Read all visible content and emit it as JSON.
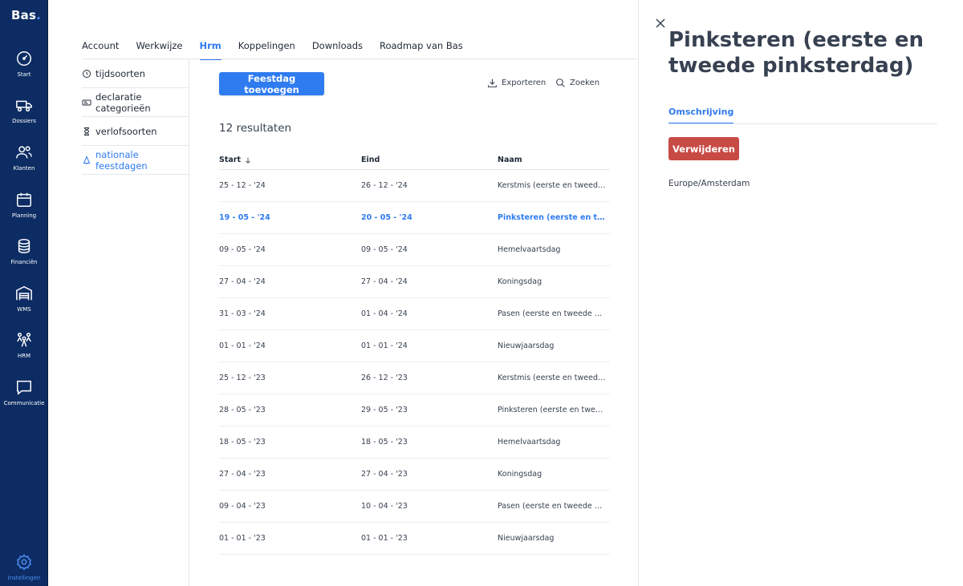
{
  "brand": {
    "name": "Bas",
    "dot": "."
  },
  "rail": [
    {
      "label": "Start",
      "icon": "gauge-icon"
    },
    {
      "label": "Dossiers",
      "icon": "truck-icon"
    },
    {
      "label": "Klanten",
      "icon": "users-icon"
    },
    {
      "label": "Planning",
      "icon": "calendar-icon"
    },
    {
      "label": "Financiën",
      "icon": "coins-icon"
    },
    {
      "label": "WMS",
      "icon": "warehouse-icon"
    },
    {
      "label": "HRM",
      "icon": "team-icon"
    },
    {
      "label": "Communicatie",
      "icon": "chat-icon"
    },
    {
      "label": "Instellingen",
      "icon": "gear-icon"
    }
  ],
  "tabs": [
    {
      "label": "Account"
    },
    {
      "label": "Werkwijze"
    },
    {
      "label": "Hrm"
    },
    {
      "label": "Koppelingen"
    },
    {
      "label": "Downloads"
    },
    {
      "label": "Roadmap van Bas"
    }
  ],
  "active_tab": "Hrm",
  "subnav": [
    {
      "label": "tijdsoorten",
      "icon": "clock-icon"
    },
    {
      "label": "declaratie categorieën",
      "icon": "receipt-icon"
    },
    {
      "label": "verlofsoorten",
      "icon": "hourglass-icon"
    },
    {
      "label": "nationale feestdagen",
      "icon": "tree-icon"
    }
  ],
  "toolbar": {
    "add_label": "Feestdag toevoegen",
    "export_label": "Exporteren",
    "search_label": "Zoeken"
  },
  "results_label": "12 resultaten",
  "table": {
    "columns": {
      "start": "Start",
      "end": "Eind",
      "name": "Naam"
    },
    "rows": [
      {
        "start": "25 - 12 - '24",
        "end": "26 - 12 - '24",
        "name": "Kerstmis (eerste en tweede kerstdag)"
      },
      {
        "start": "19 - 05 - '24",
        "end": "20 - 05 - '24",
        "name": "Pinksteren (eerste en tweede pinksterdag)"
      },
      {
        "start": "09 - 05 - '24",
        "end": "09 - 05 - '24",
        "name": "Hemelvaartsdag"
      },
      {
        "start": "27 - 04 - '24",
        "end": "27 - 04 - '24",
        "name": "Koningsdag"
      },
      {
        "start": "31 - 03 - '24",
        "end": "01 - 04 - '24",
        "name": "Pasen (eerste en tweede paasdag)"
      },
      {
        "start": "01 - 01 - '24",
        "end": "01 - 01 - '24",
        "name": "Nieuwjaarsdag"
      },
      {
        "start": "25 - 12 - '23",
        "end": "26 - 12 - '23",
        "name": "Kerstmis (eerste en tweede kerstdag)"
      },
      {
        "start": "28 - 05 - '23",
        "end": "29 - 05 - '23",
        "name": "Pinksteren (eerste en tweede pinksterdag)"
      },
      {
        "start": "18 - 05 - '23",
        "end": "18 - 05 - '23",
        "name": "Hemelvaartsdag"
      },
      {
        "start": "27 - 04 - '23",
        "end": "27 - 04 - '23",
        "name": "Koningsdag"
      },
      {
        "start": "09 - 04 - '23",
        "end": "10 - 04 - '23",
        "name": "Pasen (eerste en tweede paasdag)"
      },
      {
        "start": "01 - 01 - '23",
        "end": "01 - 01 - '23",
        "name": "Nieuwjaarsdag"
      }
    ]
  },
  "panel": {
    "title": "Pinksteren (eerste en tweede pinksterdag)",
    "tab": "Omschrijving",
    "delete_label": "Verwijderen",
    "timezone": "Europe/Amsterdam"
  },
  "colors": {
    "rail": "#0c2c63",
    "accent": "#2f7bf0",
    "danger": "#c84a45"
  }
}
